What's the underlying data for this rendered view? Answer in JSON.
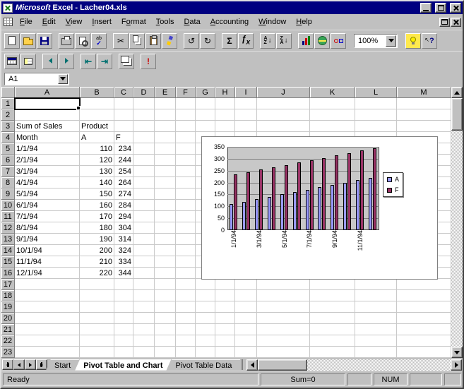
{
  "window": {
    "title": "Microsoft Excel - Lacher04.xls",
    "title_app": "Microsoft",
    "title_rest": " Excel - Lacher04.xls"
  },
  "menu": {
    "items": [
      {
        "label": "File",
        "key": "F"
      },
      {
        "label": "Edit",
        "key": "E"
      },
      {
        "label": "View",
        "key": "V"
      },
      {
        "label": "Insert",
        "key": "I"
      },
      {
        "label": "Format",
        "key": "o"
      },
      {
        "label": "Tools",
        "key": "T"
      },
      {
        "label": "Data",
        "key": "D"
      },
      {
        "label": "Accounting",
        "key": "A"
      },
      {
        "label": "Window",
        "key": "W"
      },
      {
        "label": "Help",
        "key": "H"
      }
    ]
  },
  "toolbar_standard": {
    "zoom_value": "100%",
    "buttons": [
      "new-workbook-button",
      "open-button",
      "save-button",
      "|",
      "print-button",
      "print-preview-button",
      "spelling-button",
      "|",
      "cut-button",
      "copy-button",
      "paste-button",
      "format-painter-button",
      "|",
      "undo-button",
      "repeat-button",
      "|",
      "autosum-button",
      "function-wizard-button",
      "|",
      "sort-ascending-button",
      "sort-descending-button",
      "|",
      "chart-wizard-button",
      "map-button",
      "drawing-button",
      "|",
      "zoom-combobox",
      "|",
      "tip-wizard-button",
      "help-button"
    ]
  },
  "toolbar_query_pivot": {
    "buttons": [
      "pivot-table-wizard-button",
      "pivot-table-field-button",
      "|",
      "hide-detail-button",
      "show-detail-button",
      "|",
      "ungroup-button",
      "group-button",
      "|",
      "show-pages-button",
      "|",
      "refresh-data-button"
    ]
  },
  "formula_bar": {
    "name_box": "A1",
    "formula": ""
  },
  "grid": {
    "columns": [
      "A",
      "B",
      "C",
      "D",
      "E",
      "F",
      "G",
      "H",
      "I",
      "J",
      "K",
      "L",
      "M"
    ],
    "rows": [
      "1",
      "2",
      "3",
      "4",
      "5",
      "6",
      "7",
      "8",
      "9",
      "10",
      "11",
      "12",
      "13",
      "14",
      "15",
      "16",
      "17",
      "18",
      "19",
      "20",
      "21",
      "22",
      "23"
    ],
    "selection": "A1",
    "cells": {
      "A3": "Sum of Sales",
      "B3": "Product",
      "A4": "Month",
      "B4": "A",
      "C4": "F",
      "A5": "1/1/94",
      "B5": "110",
      "C5": "234",
      "A6": "2/1/94",
      "B6": "120",
      "C6": "244",
      "A7": "3/1/94",
      "B7": "130",
      "C7": "254",
      "A8": "4/1/94",
      "B8": "140",
      "C8": "264",
      "A9": "5/1/94",
      "B9": "150",
      "C9": "274",
      "A10": "6/1/94",
      "B10": "160",
      "C10": "284",
      "A11": "7/1/94",
      "B11": "170",
      "C11": "294",
      "A12": "8/1/94",
      "B12": "180",
      "C12": "304",
      "A13": "9/1/94",
      "B13": "190",
      "C13": "314",
      "A14": "10/1/94",
      "B14": "200",
      "C14": "324",
      "A15": "11/1/94",
      "B15": "210",
      "C15": "334",
      "A16": "12/1/94",
      "B16": "220",
      "C16": "344"
    }
  },
  "chart_data": {
    "type": "bar",
    "categories": [
      "1/1/94",
      "2/1/94",
      "3/1/94",
      "4/1/94",
      "5/1/94",
      "6/1/94",
      "7/1/94",
      "8/1/94",
      "9/1/94",
      "10/1/94",
      "11/1/94",
      "12/1/94"
    ],
    "series": [
      {
        "name": "A",
        "color": "#9999ff",
        "values": [
          110,
          120,
          130,
          140,
          150,
          160,
          170,
          180,
          190,
          200,
          210,
          220
        ]
      },
      {
        "name": "F",
        "color": "#993366",
        "values": [
          234,
          244,
          254,
          264,
          274,
          284,
          294,
          304,
          314,
          324,
          334,
          344
        ]
      }
    ],
    "title": "",
    "xlabel": "",
    "ylabel": "",
    "ylim": [
      0,
      350
    ],
    "y_step": 50,
    "y_tick_labels": [
      "350",
      "300",
      "250",
      "200",
      "150",
      "100",
      "50",
      "0"
    ],
    "x_tick_labels": [
      "1/1/94",
      "3/1/94",
      "5/1/94",
      "7/1/94",
      "9/1/94",
      "11/1/94"
    ],
    "grid": true,
    "legend_position": "right",
    "plot_bg": "#c8c8c8"
  },
  "sheet_tabs": {
    "tabs": [
      {
        "label": "Start",
        "active": false
      },
      {
        "label": "Pivot Table and Chart",
        "active": true
      },
      {
        "label": "Pivot Table Data",
        "active": false
      }
    ]
  },
  "status_bar": {
    "mode": "Ready",
    "autocalc": "Sum=0",
    "num_lock": "NUM"
  }
}
